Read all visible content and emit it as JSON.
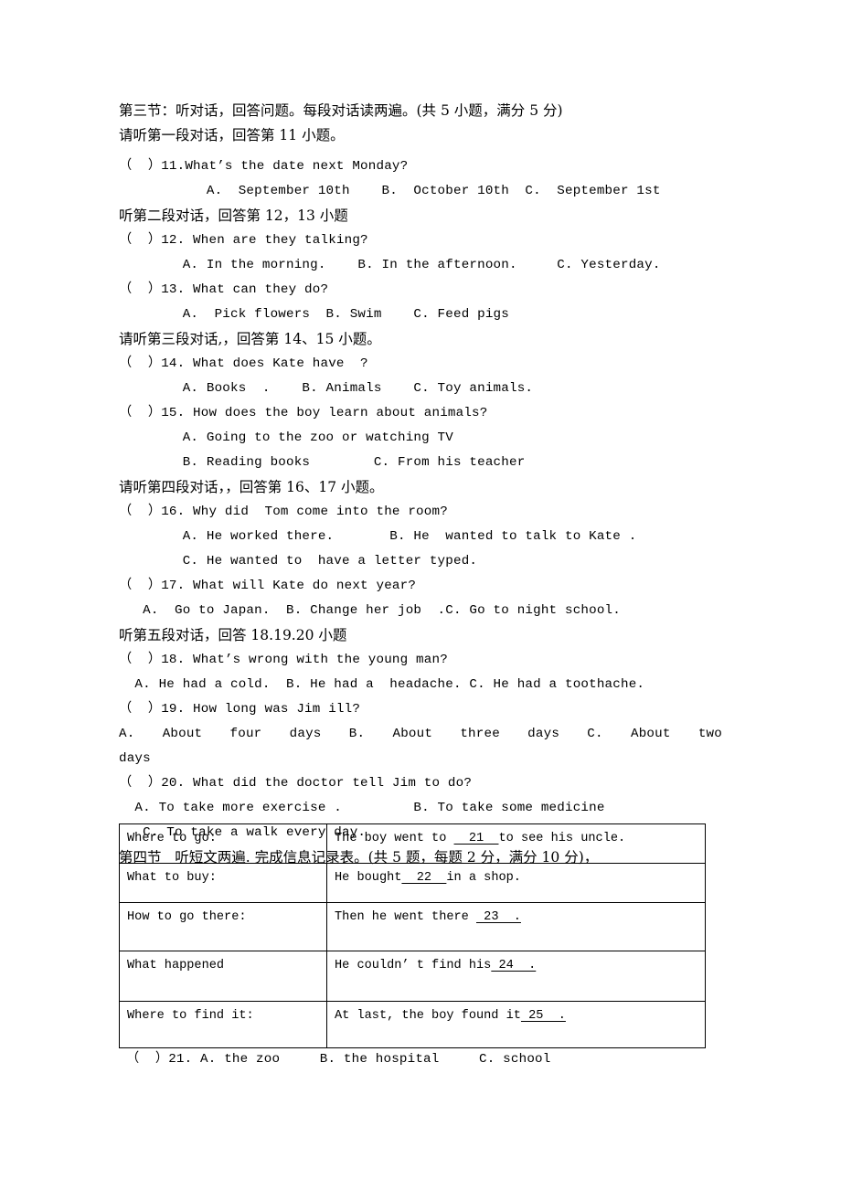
{
  "document": {
    "section3": {
      "heading": "第三节：听对话，回答问题。每段对话读两遍。(共 5 小题，满分 5 分)",
      "dialog1_instruction": "请听第一段对话，回答第 11 小题。",
      "q11": "（  ）11.What’s the date next Monday?",
      "q11_options": "           A.  September 10th    B.  October 10th  C.  September 1st",
      "dialog2_instruction": "听第二段对话，回答第 12，13 小题",
      "q12": "（  ）12. When are they talking?",
      "q12_options": "        A. In the morning.    B. In the afternoon.     C. Yesterday.",
      "q13": "（  ）13. What can they do?",
      "q13_options": "        A.  Pick flowers  B. Swim    C. Feed pigs",
      "dialog3_instruction": "请听第三段对话,，回答第 14、15 小题。",
      "q14": "（  ）14. What does Kate have  ?",
      "q14_options": "        A. Books  .    B. Animals    C. Toy animals.",
      "q15": "（  ）15. How does the boy learn about animals?",
      "q15_option_a": "        A. Going to the zoo or watching TV",
      "q15_option_bc": "        B. Reading books        C. From his teacher",
      "dialog4_instruction": "请听第四段对话，，回答第 16、17 小题。",
      "q16": "（  ）16. Why did  Tom come into the room?",
      "q16_options_ab": "        A. He worked there.       B. He  wanted to talk to Kate .",
      "q16_option_c": "        C. He wanted to  have a letter typed.",
      "q17": "（  ）17. What will Kate do next year?",
      "q17_options": "   A.  Go to Japan.  B. Change her job  .C. Go to night school.",
      "dialog5_instruction": "听第五段对话，回答 18.19.20 小题",
      "q18": "（  ）18. What’s wrong with the young man?",
      "q18_options": "  A. He had a cold.  B. He had a  headache. C. He had a toothache.",
      "q19": "（  ）19. How long was Jim ill?",
      "q19_options_justified": "A. About four days B. About three days C. About two",
      "q19_overflow": "days",
      "q20": "（  ）20. What did the doctor tell Jim to do?",
      "q20_options_ab": "  A. To take more exercise .         B. To take some medicine",
      "q20_option_c": "   C. To take a walk every day."
    },
    "section4": {
      "heading": "第四节   听短文两遍. 完成信息记录表。(共 5 题，每题 2 分，满分 10 分)，",
      "table": {
        "rows": [
          {
            "label": "Where to go:",
            "value_before": "The boy went to ",
            "blank": "  21  ",
            "value_after": "to see his uncle."
          },
          {
            "label": "What to buy:",
            "value_before": "He bought",
            "blank": "  22  ",
            "value_after": "in a shop."
          },
          {
            "label": "How to go there:",
            "value_before": "Then he went there ",
            "blank": " 23  .",
            "value_after": ""
          },
          {
            "label": "What happened",
            "value_before": "He couldn’ t find his",
            "blank": " 24  .",
            "value_after": ""
          },
          {
            "label": "Where to find it:",
            "value_before": "At last, the boy found it",
            "blank": " 25  .",
            "value_after": ""
          }
        ]
      },
      "q21": "（  ）21. A. the zoo     B. the hospital     C. school"
    }
  }
}
